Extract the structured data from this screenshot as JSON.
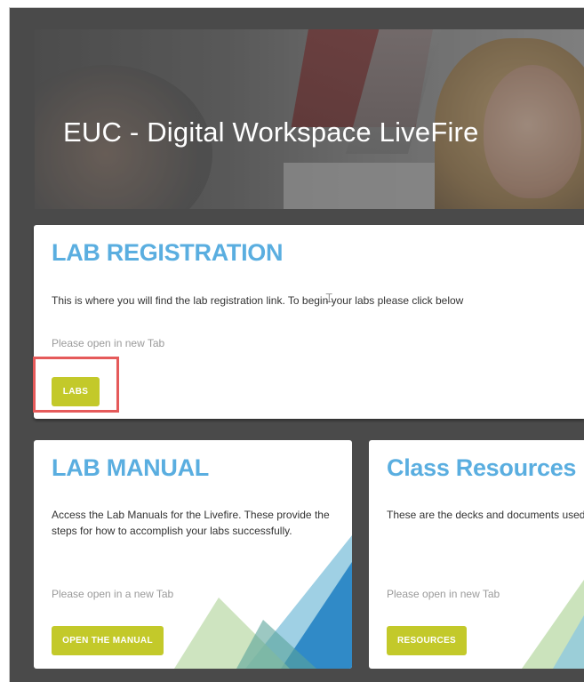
{
  "hero": {
    "title": "EUC - Digital Workspace LiveFire"
  },
  "registration": {
    "title": "LAB REGISTRATION",
    "description": "This is where you will find the lab registration link. To begin your labs please click below",
    "note": "Please open in new Tab",
    "button_label": "LABS"
  },
  "manual": {
    "title": "LAB MANUAL",
    "description": "Access the Lab Manuals for the Livefire. These provide the steps for how to accomplish your labs successfully.",
    "note": "Please open in a new Tab",
    "button_label": "OPEN THE MANUAL"
  },
  "resources": {
    "title": "Class Resources",
    "description": "These are the decks and documents used",
    "note": "Please open in new Tab",
    "button_label": "RESOURCES"
  },
  "colors": {
    "frame_bg": "#4a4a4a",
    "title_blue": "#5aaee0",
    "button_green": "#c3c92a",
    "highlight_red": "#e55a5a"
  },
  "icons": {
    "cursor": "text-cursor-icon"
  }
}
